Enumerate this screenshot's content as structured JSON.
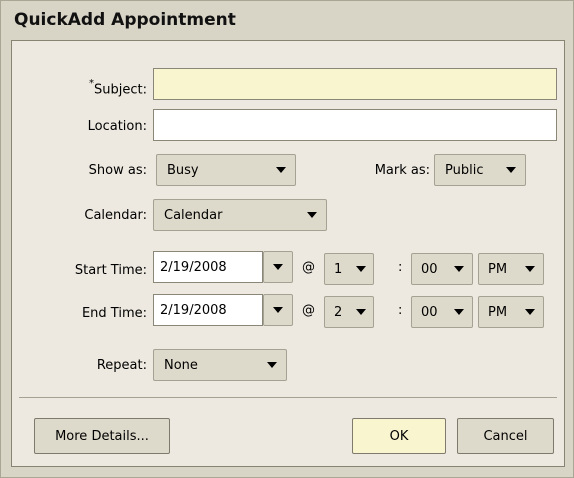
{
  "dialog": {
    "title": "QuickAdd Appointment"
  },
  "form": {
    "subject": {
      "required_mark": "*",
      "label": "Subject:",
      "value": ""
    },
    "location": {
      "label": "Location:",
      "value": ""
    },
    "show_as": {
      "label": "Show as:",
      "selected": "Busy"
    },
    "mark_as": {
      "label": "Mark as:",
      "selected": "Public"
    },
    "calendar": {
      "label": "Calendar:",
      "selected": "Calendar"
    },
    "start_time": {
      "label": "Start Time:",
      "date": "2/19/2008",
      "at": "@",
      "hour": "1",
      "colon": ":",
      "minute": "00",
      "ampm": "PM"
    },
    "end_time": {
      "label": "End Time:",
      "date": "2/19/2008",
      "at": "@",
      "hour": "2",
      "colon": ":",
      "minute": "00",
      "ampm": "PM"
    },
    "repeat": {
      "label": "Repeat:",
      "selected": "None"
    }
  },
  "buttons": {
    "more_details": "More Details...",
    "ok": "OK",
    "cancel": "Cancel"
  }
}
